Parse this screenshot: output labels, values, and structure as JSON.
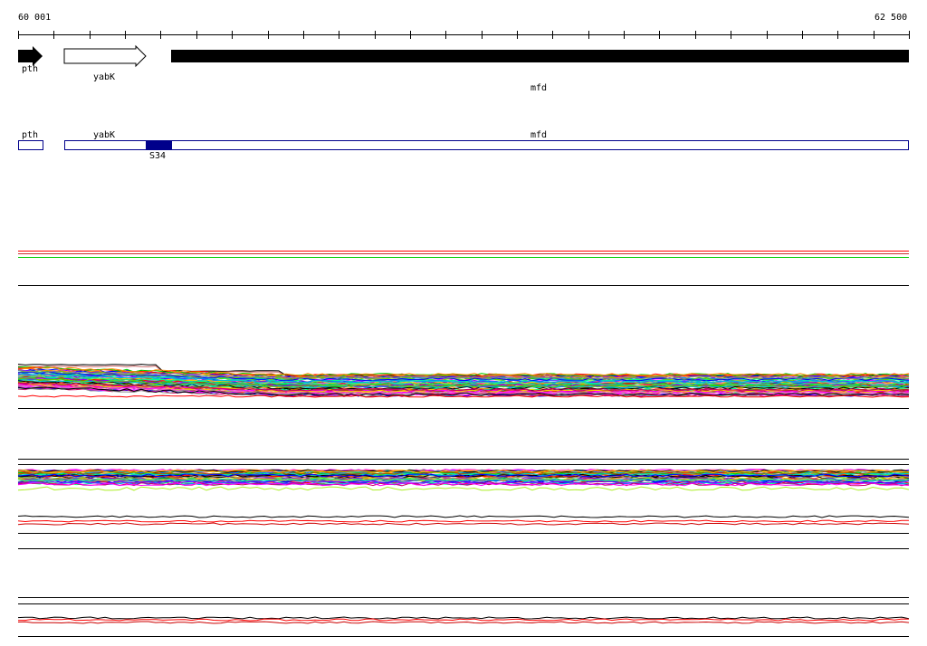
{
  "ruler": {
    "start_label": "60 001",
    "end_label": "62 500"
  },
  "genes": [
    {
      "name": "pth",
      "strand": "+",
      "filled": true
    },
    {
      "name": "yabK",
      "strand": "+",
      "filled": false
    },
    {
      "name": "mfd",
      "strand": "+",
      "filled": true
    }
  ],
  "annotation": {
    "segments": [
      {
        "name": "pth"
      },
      {
        "name": "yabK"
      },
      {
        "name": "mfd"
      }
    ],
    "feature": {
      "name": "S34",
      "color": "#00008b"
    }
  },
  "colors": {
    "axis": "#000000",
    "annotation_outline": "#00008b",
    "red": "#ff0000",
    "green": "#00cc00"
  }
}
